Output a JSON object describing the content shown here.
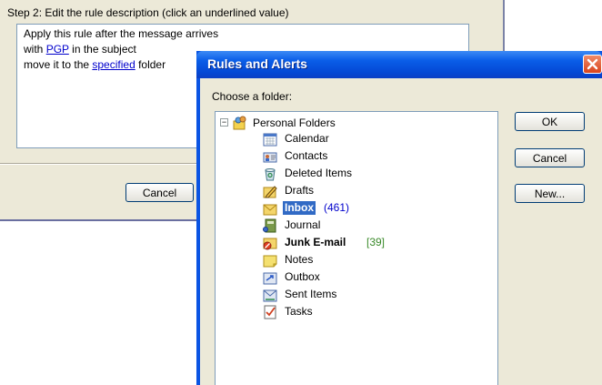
{
  "wizard": {
    "step_label": "Step 2: Edit the rule description (click an underlined value)",
    "rule_lines": {
      "line1": "Apply this rule after the message arrives",
      "line2_pre": "with ",
      "line2_link": "PGP",
      "line2_post": " in the subject",
      "line3_pre": "move it to the ",
      "line3_link": "specified",
      "line3_post": " folder"
    },
    "cancel_label": "Cancel"
  },
  "dialog": {
    "title": "Rules and Alerts",
    "choose_label": "Choose a folder:",
    "ok_label": "OK",
    "cancel_label": "Cancel",
    "new_label": "New...",
    "root": {
      "expander": "−",
      "label": "Personal Folders",
      "icon": "personal-folders-icon"
    },
    "folders": [
      {
        "label": "Calendar",
        "icon": "calendar-icon",
        "count": ""
      },
      {
        "label": "Contacts",
        "icon": "contacts-icon",
        "count": ""
      },
      {
        "label": "Deleted Items",
        "icon": "deleted-items-icon",
        "count": ""
      },
      {
        "label": "Drafts",
        "icon": "drafts-icon",
        "count": ""
      },
      {
        "label": "Inbox",
        "icon": "inbox-icon",
        "count": "(461)",
        "selected": true,
        "bold": true
      },
      {
        "label": "Journal",
        "icon": "journal-icon",
        "count": ""
      },
      {
        "label": "Junk E-mail",
        "icon": "junk-email-icon",
        "count": "[39]",
        "bold": true
      },
      {
        "label": "Notes",
        "icon": "notes-icon",
        "count": ""
      },
      {
        "label": "Outbox",
        "icon": "outbox-icon",
        "count": ""
      },
      {
        "label": "Sent Items",
        "icon": "sent-items-icon",
        "count": ""
      },
      {
        "label": "Tasks",
        "icon": "tasks-icon",
        "count": ""
      }
    ]
  },
  "colors": {
    "titlebar": "#0a5ee8",
    "selection": "#316ac5",
    "link": "#0000cc",
    "dialog_face": "#ece9d8"
  }
}
